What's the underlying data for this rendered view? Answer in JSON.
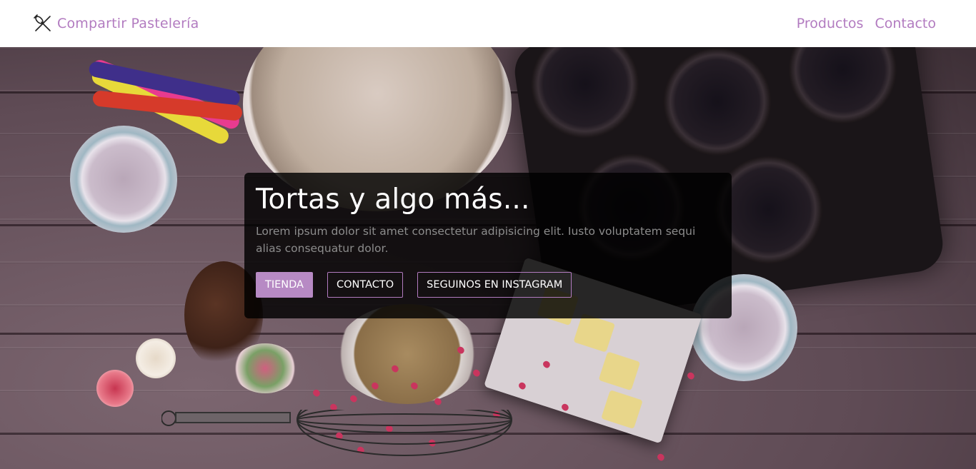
{
  "navbar": {
    "brand_icon": "whisk-rolling-pin-icon",
    "brand_text": "Compartir Pastelería",
    "links": [
      "Productos",
      "Contacto"
    ]
  },
  "hero": {
    "title": "Tortas y algo más...",
    "description": "Lorem ipsum dolor sit amet consectetur adipisicing elit. Iusto voluptatem sequi alias consequatur dolor.",
    "buttons": {
      "shop": "TIENDA",
      "contact": "CONTACTO",
      "instagram": "SEGUINOS EN INSTAGRAM"
    }
  },
  "colors": {
    "accent": "#b27bc0",
    "primary_button": "#b78ac4",
    "overlay": "#000000",
    "description_text": "#8c8c8c"
  }
}
